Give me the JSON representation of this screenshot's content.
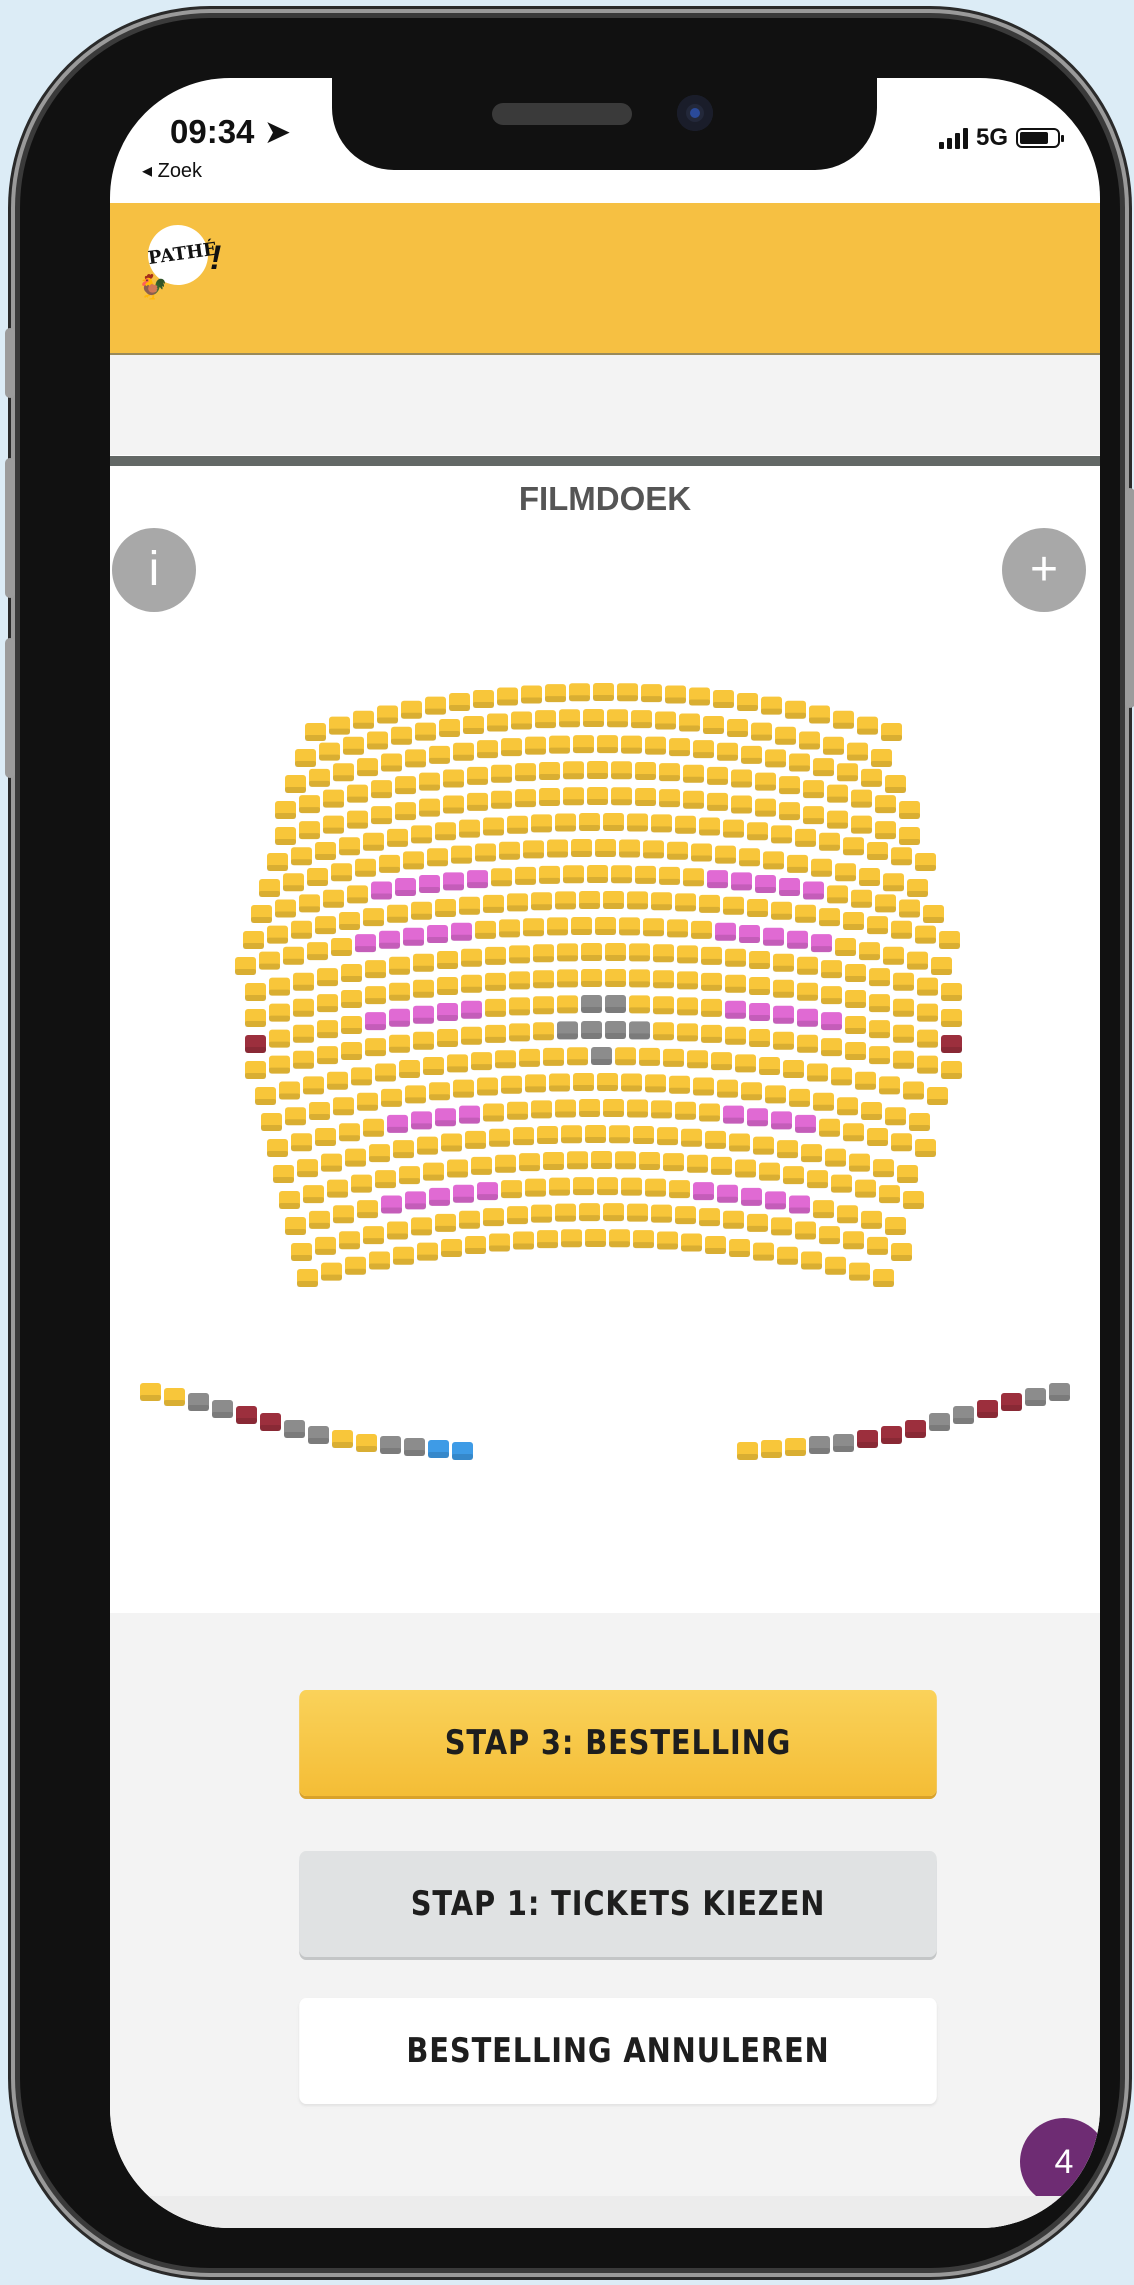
{
  "status_bar": {
    "time": "09:34 ➤",
    "back_link": "◂ Zoek",
    "network": "5G"
  },
  "brand": {
    "logo_text": "PATHÉ",
    "logo_mark": "!",
    "rooster": "🐓"
  },
  "seatmap": {
    "screen_label": "FILMDOEK",
    "info_button": "i",
    "zoom_button": "+",
    "colors": {
      "available": "#f8c63a",
      "premium": "#e06ad3",
      "occupied": "#8c8c8c",
      "accessible": "#9c2f3d",
      "selected": "#3e9be6"
    }
  },
  "actions": {
    "step3": "STAP 3: BESTELLING",
    "step1": "STAP 1: TICKETS KIEZEN",
    "cancel": "BESTELLING ANNULEREN"
  },
  "badge": {
    "count": "4"
  }
}
